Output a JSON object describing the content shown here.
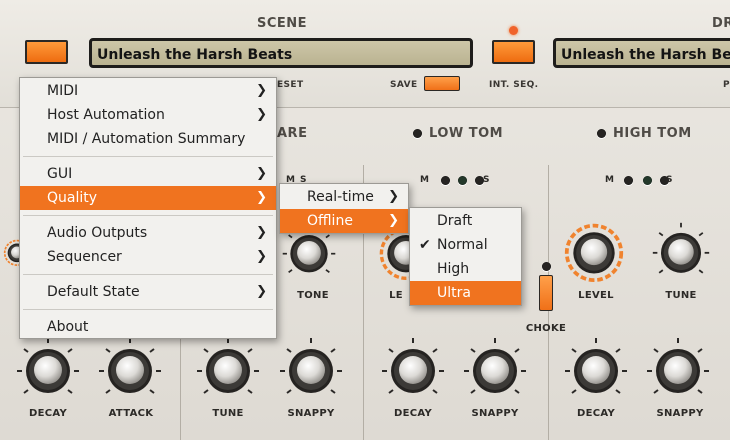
{
  "header": {
    "scene_title": "SCENE",
    "drum_title": "DR",
    "scene_name": "Unleash the Harsh Beats",
    "drum_name": "Unleash the Harsh Beats",
    "preset_label": "ESET",
    "save_label": "SAVE",
    "int_seq_label": "INT. SEQ.",
    "right_label_fragment": "P"
  },
  "channels": {
    "snare_title": "ARE",
    "low_tom_title": "LOW TOM",
    "high_tom_title": "HIGH TOM",
    "m_label": "M",
    "s_label": "S"
  },
  "knobs": {
    "tone": "TONE",
    "level_low": "LE",
    "level_high": "LEVEL",
    "tune": "TUNE",
    "decay": "DECAY",
    "attack": "ATTACK",
    "snappy": "SNAPPY",
    "choke": "CHOKE"
  },
  "main_menu": {
    "items": [
      "MIDI",
      "Host Automation",
      "MIDI / Automation Summary",
      "GUI",
      "Quality",
      "Audio Outputs",
      "Sequencer",
      "Default State",
      "About"
    ],
    "highlighted": "Quality"
  },
  "quality_submenu": {
    "items": [
      "Real-time",
      "Offline"
    ],
    "highlighted": "Offline"
  },
  "offline_submenu": {
    "items": [
      "Draft",
      "Normal",
      "High",
      "Ultra"
    ],
    "checked": "Normal",
    "highlighted": "Ultra"
  },
  "icons": {
    "submenu_arrow": "chevron-right-icon",
    "checkmark": "checkmark-icon"
  },
  "colors": {
    "accent_orange": "#f0731f",
    "lcd": "#c6bf9f",
    "panel": "#e6e3dd"
  }
}
